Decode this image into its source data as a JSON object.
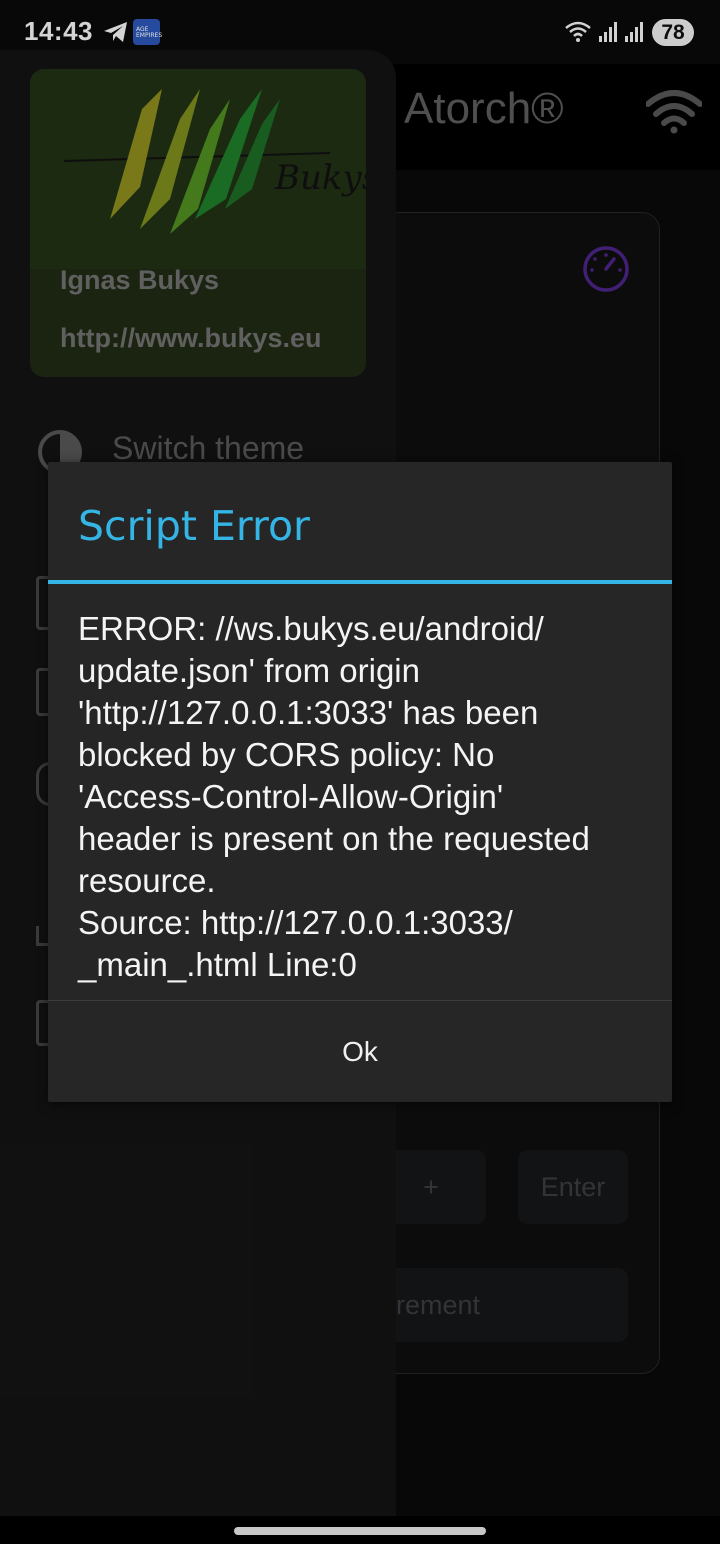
{
  "status_bar": {
    "time": "14:43",
    "app_badge_text": "AGE EMPIRES",
    "battery": "78"
  },
  "app": {
    "title": "Atorch®",
    "buttons": {
      "plus": "+",
      "enter": "Enter",
      "measurement_partial": "rement"
    }
  },
  "drawer": {
    "author_name": "Ignas Bukys",
    "author_url": "http://www.bukys.eu",
    "logo_signature": "Bukys.",
    "items": [
      {
        "label": "Switch theme",
        "icon": "contrast-icon"
      }
    ]
  },
  "dialog": {
    "title": "Script Error",
    "message_lines": [
      "ERROR: //ws.bukys.eu/android/",
      "update.json' from origin",
      "'http://127.0.0.1:3033' has been",
      "blocked by CORS policy: No",
      "'Access-Control-Allow-Origin'",
      "header is present on the requested",
      "resource.",
      "Source: http://127.0.0.1:3033/",
      "_main_.html Line:0"
    ],
    "ok_label": "Ok"
  },
  "colors": {
    "accent": "#35b5e5",
    "dialog_bg": "#262626",
    "drawer_bg": "#131313",
    "gauge_purple": "#5b2a9e"
  }
}
